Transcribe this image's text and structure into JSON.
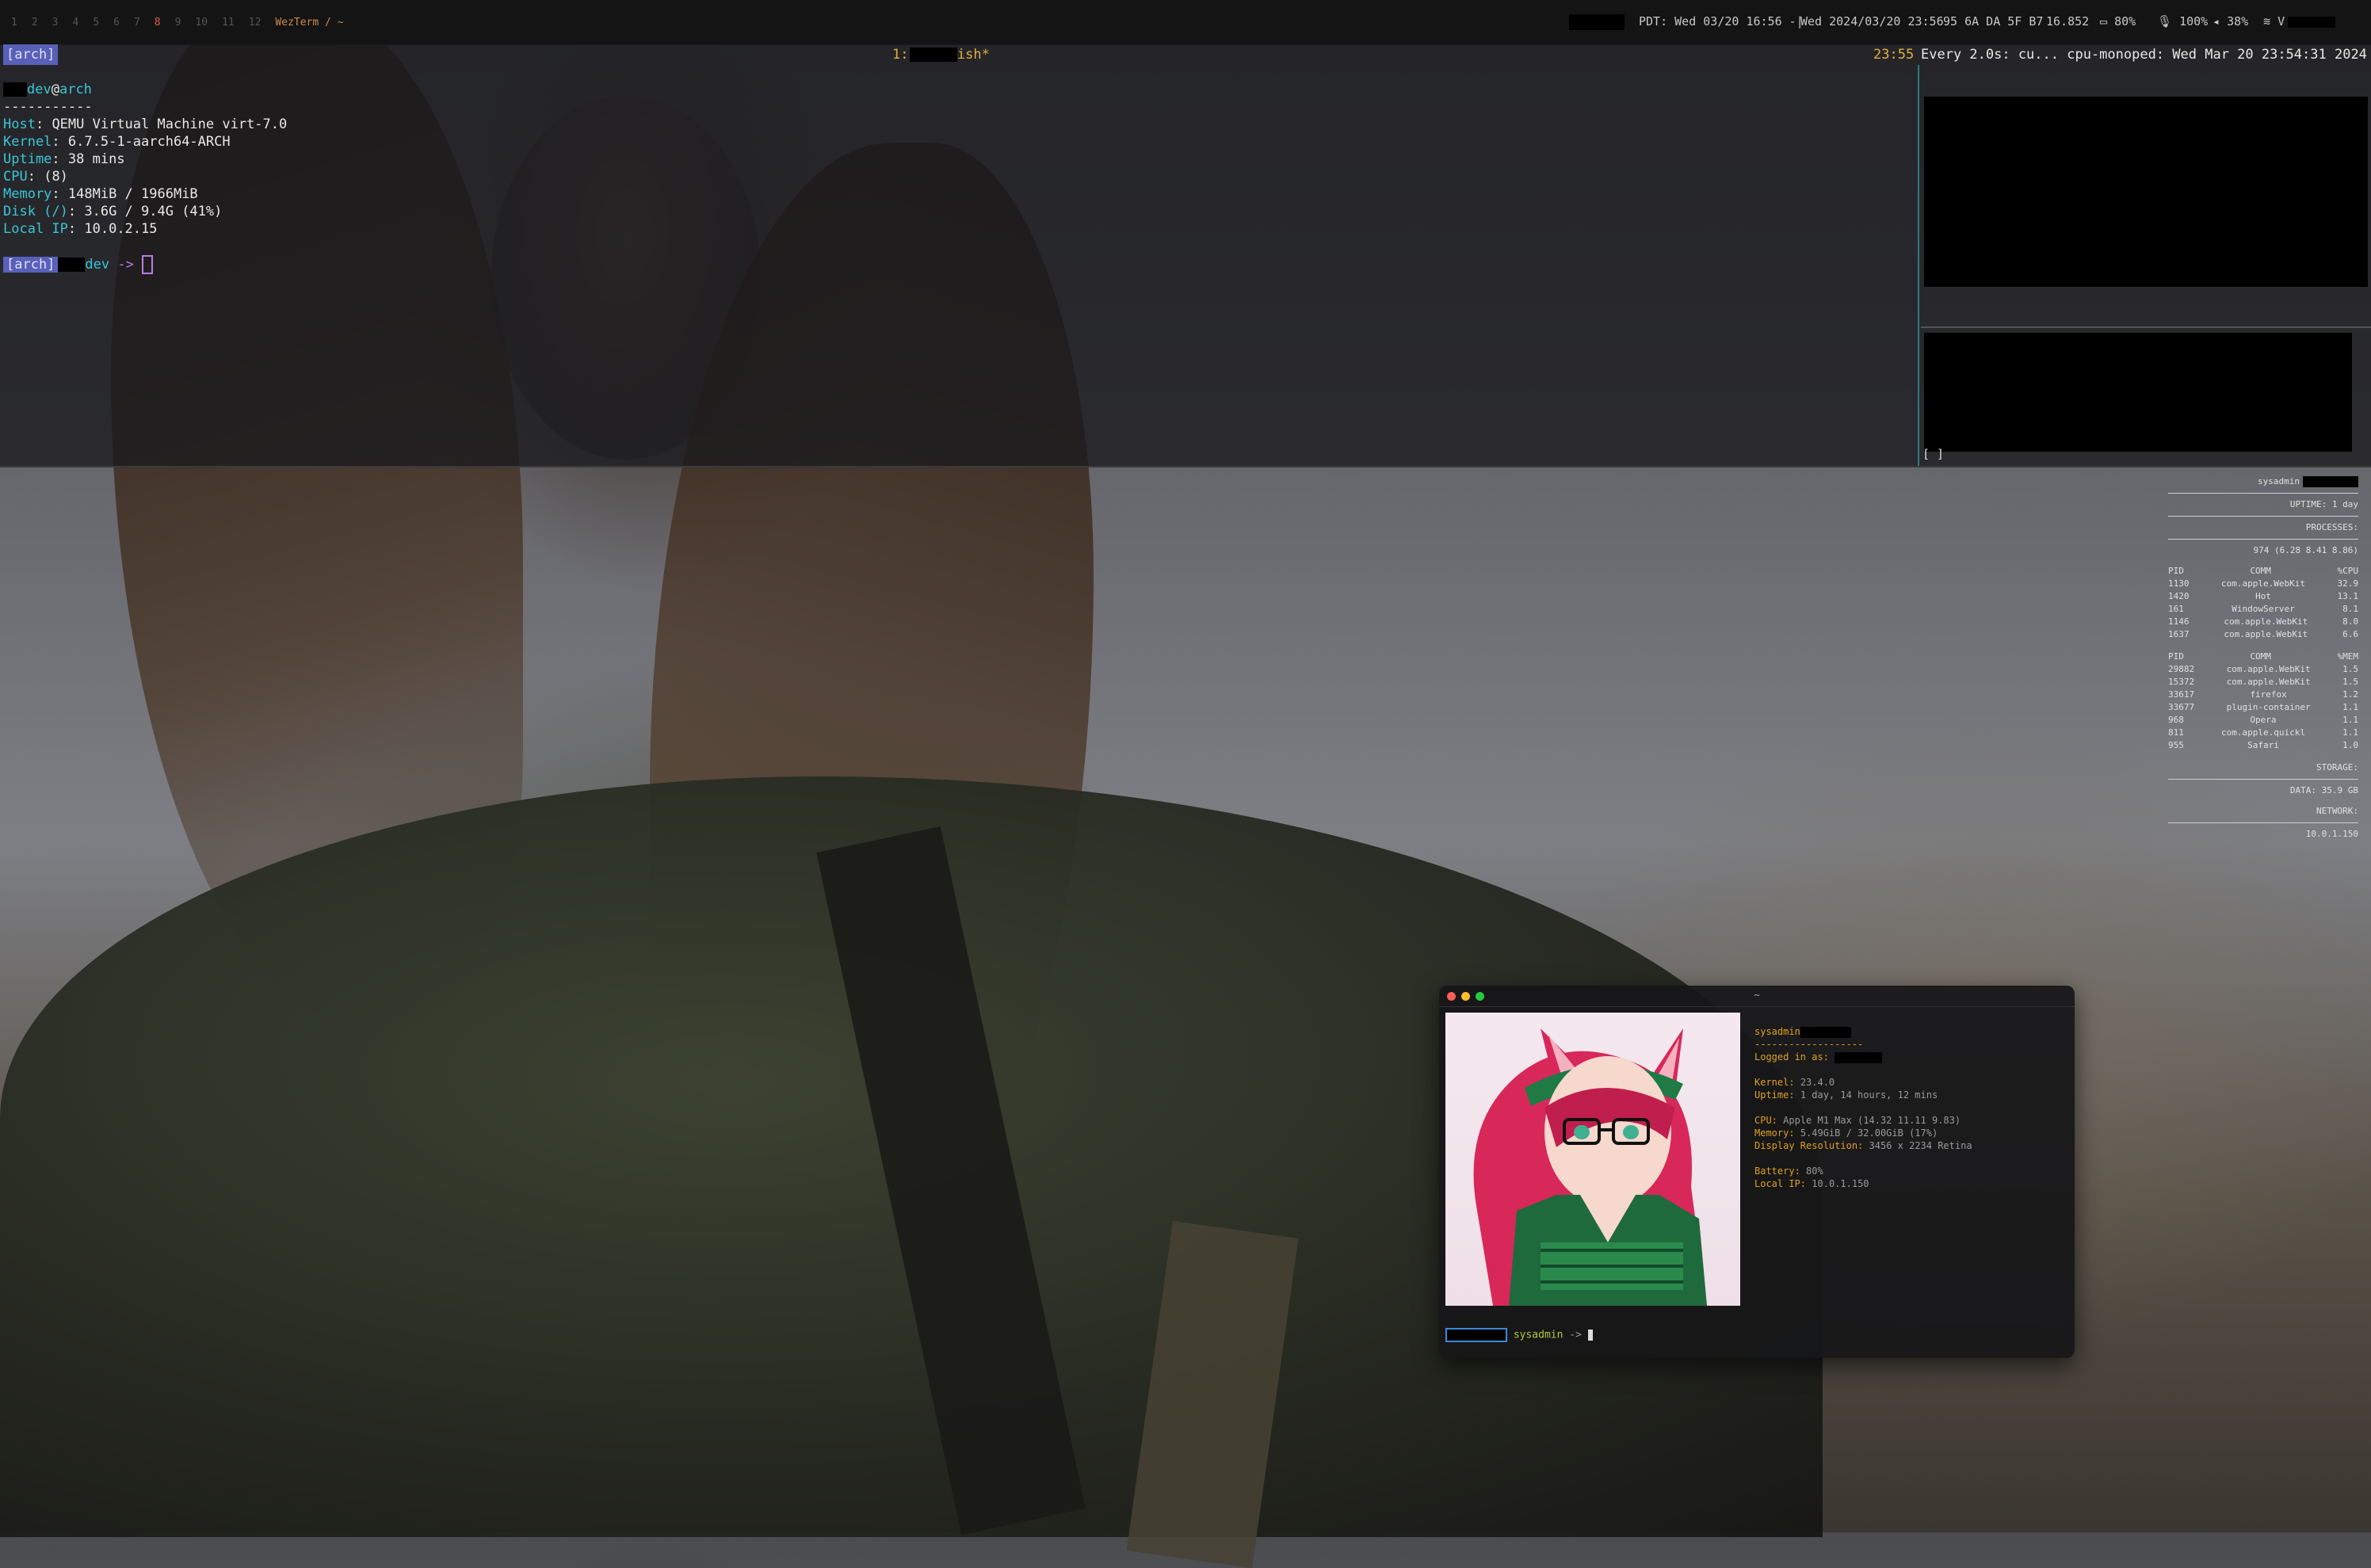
{
  "topbar": {
    "workspaces": [
      "1",
      "2",
      "3",
      "4",
      "5",
      "6",
      "7",
      "8",
      "9",
      "10",
      "11",
      "12"
    ],
    "active_app": "WezTerm / ~",
    "pdt": "PDT: Wed 03/20 16:56 -|",
    "datetime": "Wed 2024/03/20 23:56",
    "hex": "95 6A DA 5F B7",
    "load": "16.852",
    "battery": "80%",
    "volume": "100%",
    "brightness": "38%",
    "wifi": "V"
  },
  "tmux": {
    "session_tag": "[arch]",
    "windows": "1:        - 2:fish*",
    "clock": "23:55",
    "right_title": "Every 2.0s: cu...   cpu-monoped: Wed Mar 20 23:54:31 2024",
    "user_host_user": "dev",
    "user_host_at": "@",
    "user_host_host": "arch",
    "dashes": "-----------",
    "info": [
      {
        "k": "Host",
        "v": "QEMU Virtual Machine virt-7.0"
      },
      {
        "k": "Kernel",
        "v": "6.7.5-1-aarch64-ARCH"
      },
      {
        "k": "Uptime",
        "v": "38 mins"
      },
      {
        "k": "CPU",
        "v": "(8)"
      },
      {
        "k": "Memory",
        "v": "148MiB / 1966MiB"
      },
      {
        "k": "Disk (/)",
        "v": "3.6G / 9.4G (41%)"
      },
      {
        "k": "Local IP",
        "v": "10.0.2.15"
      }
    ],
    "prompt_tag": "[arch]",
    "prompt_user": "dev",
    "prompt_arrow": "->",
    "bottom_tag": "[   ]"
  },
  "conky": {
    "user": "sysadmin",
    "uptime": "UPTIME: 1 day",
    "processes": "PROCESSES:",
    "load": "974 (6.28 8.41 8.86)",
    "cpu_hdr": {
      "pid": "PID",
      "comm": "COMM",
      "pct": "%CPU"
    },
    "cpu": [
      {
        "pid": "1130",
        "comm": "com.apple.WebKit",
        "pct": "32.9"
      },
      {
        "pid": "1420",
        "comm": "Hot",
        "pct": "13.1"
      },
      {
        "pid": "161",
        "comm": "WindowServer",
        "pct": "8.1"
      },
      {
        "pid": "1146",
        "comm": "com.apple.WebKit",
        "pct": "8.0"
      },
      {
        "pid": "1637",
        "comm": "com.apple.WebKit",
        "pct": "6.6"
      }
    ],
    "mem_hdr": {
      "pid": "PID",
      "comm": "COMM",
      "pct": "%MEM"
    },
    "mem": [
      {
        "pid": "29882",
        "comm": "com.apple.WebKit",
        "pct": "1.5"
      },
      {
        "pid": "15372",
        "comm": "com.apple.WebKit",
        "pct": "1.5"
      },
      {
        "pid": "33617",
        "comm": "firefox",
        "pct": "1.2"
      },
      {
        "pid": "33677",
        "comm": "plugin-container",
        "pct": "1.1"
      },
      {
        "pid": "968",
        "comm": "Opera",
        "pct": "1.1"
      },
      {
        "pid": "811",
        "comm": "com.apple.quickl",
        "pct": "1.1"
      },
      {
        "pid": "955",
        "comm": "Safari",
        "pct": "1.0"
      }
    ],
    "storage_label": "STORAGE:",
    "storage": "DATA: 35.9 GB",
    "network_label": "NETWORK:",
    "ip": "10.0.1.150"
  },
  "mac": {
    "title": "~",
    "user": "sysadmin",
    "dashes": "-------------------",
    "logged_label": "Logged in as:",
    "kernel_label": "Kernel:",
    "kernel": "23.4.0",
    "uptime_label": "Uptime:",
    "uptime": "1 day, 14 hours, 12 mins",
    "cpu_label": "CPU:",
    "cpu": "Apple M1 Max (14.32 11.11 9.83)",
    "memory_label": "Memory:",
    "memory": "5.49GiB / 32.00GiB (17%)",
    "display_label": "Display Resolution:",
    "display": "3456 x 2234 Retina",
    "battery_label": "Battery:",
    "battery": "80%",
    "ip_label": "Local IP:",
    "ip": "10.0.1.150",
    "prompt_user": "sysadmin",
    "prompt_arrow": "->",
    "colors": {
      "red": "#ff5f57",
      "yellow": "#febc2e",
      "green": "#28c840"
    }
  }
}
